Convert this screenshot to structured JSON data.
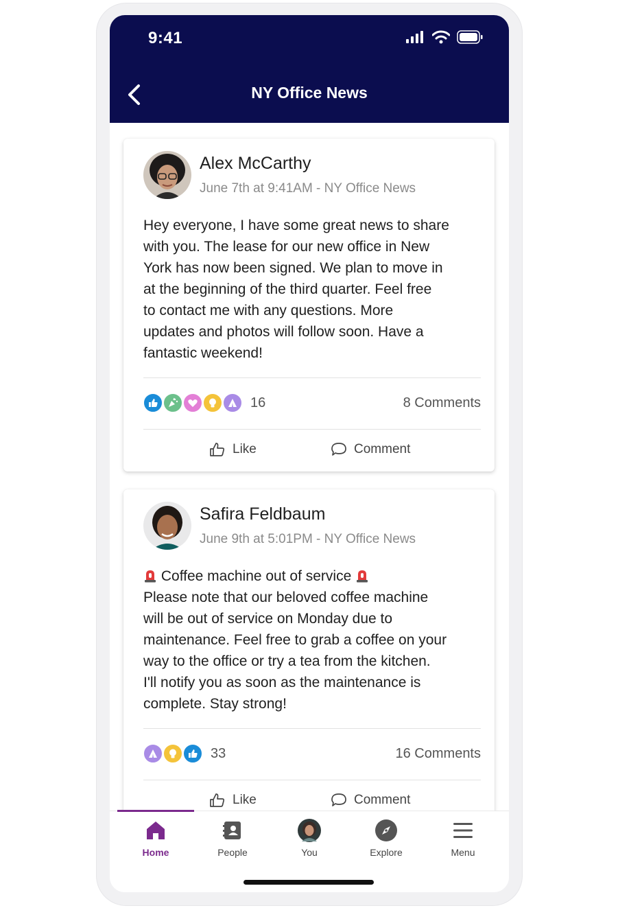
{
  "status_bar": {
    "time": "9:41"
  },
  "header": {
    "title": "NY Office News"
  },
  "posts": [
    {
      "author": "Alex McCarthy",
      "meta": "June 7th at 9:41AM - NY Office News",
      "body_lines": [
        "Hey everyone, I have some great news to share",
        "with you. The lease for our new office in New",
        "York has now been signed. We plan to move in",
        "at the beginning of the third quarter. Feel free",
        "to contact me with any questions. More",
        "updates and photos will follow soon. Have a",
        "fantastic weekend!"
      ],
      "reactions": [
        "like",
        "celebrate",
        "love",
        "insightful",
        "thanks"
      ],
      "reaction_count": "16",
      "comments": "8 Comments",
      "like_label": "Like",
      "comment_label": "Comment"
    },
    {
      "author": "Safira Feldbaum",
      "meta": "June 9th at 5:01PM - NY Office News",
      "body_title": "Coffee machine out of service",
      "body_lines": [
        "Please note that our beloved coffee machine",
        "will be out of service on Monday due to",
        "maintenance. Feel free to grab a coffee on your",
        "way to the office or try a tea from the kitchen.",
        "I'll notify you as soon as the maintenance is",
        "complete. Stay strong!"
      ],
      "reactions": [
        "thanks",
        "insightful",
        "like"
      ],
      "reaction_count": "33",
      "comments": "16 Comments",
      "like_label": "Like",
      "comment_label": "Comment"
    }
  ],
  "nav": [
    {
      "label": "Home",
      "icon": "home-icon",
      "active": true
    },
    {
      "label": "People",
      "icon": "people-icon"
    },
    {
      "label": "You",
      "icon": "avatar"
    },
    {
      "label": "Explore",
      "icon": "compass-icon"
    },
    {
      "label": "Menu",
      "icon": "menu-icon"
    }
  ],
  "colors": {
    "header_bg": "#0b0d4f",
    "accent": "#7b2a8d",
    "like": "#1a8cd8",
    "celebrate": "#6cc08b",
    "love": "#e37fd6",
    "insightful": "#f4c33a",
    "thanks": "#a98be6"
  }
}
